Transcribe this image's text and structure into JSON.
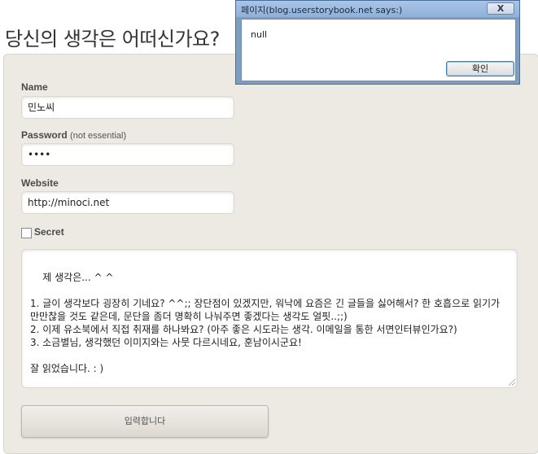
{
  "page": {
    "title": "당신의 생각은 어떠신가요?"
  },
  "form": {
    "name_label": "Name",
    "name_value": "민노씨",
    "password_label": "Password",
    "password_hint": "(not essential)",
    "password_value": "••••",
    "website_label": "Website",
    "website_value": "http://minoci.net",
    "secret_label": "Secret",
    "secret_checked": false,
    "comment_text": "제 생각은... ^ ^\n\n1. 글이 생각보다 굉장히 기네요? ^^;; 장단점이 있겠지만, 워낙에 요즘은 긴 글들을 싫어해서? 한 호흡으로 읽기가 만만찮을 것도 같은데, 문단을 좀더 명확히 나눠주면 좋겠다는 생각도 얼핏..;;)\n2. 이제 유소북에서 직접 취재를 하나봐요? (아주 좋은 시도라는 생각. 이메일을 통한 서면인터뷰인가요?)\n3. 소금별님, 생각했던 이미지와는 사뭇 다르시네요, 훈남이시군요!\n\n잘 읽었습니다. : )",
    "submit_label": "입력합니다"
  },
  "dialog": {
    "title": "페이지(blog.userstorybook.net says:)",
    "close_label": "X",
    "message": "null",
    "ok_label": "확인"
  }
}
